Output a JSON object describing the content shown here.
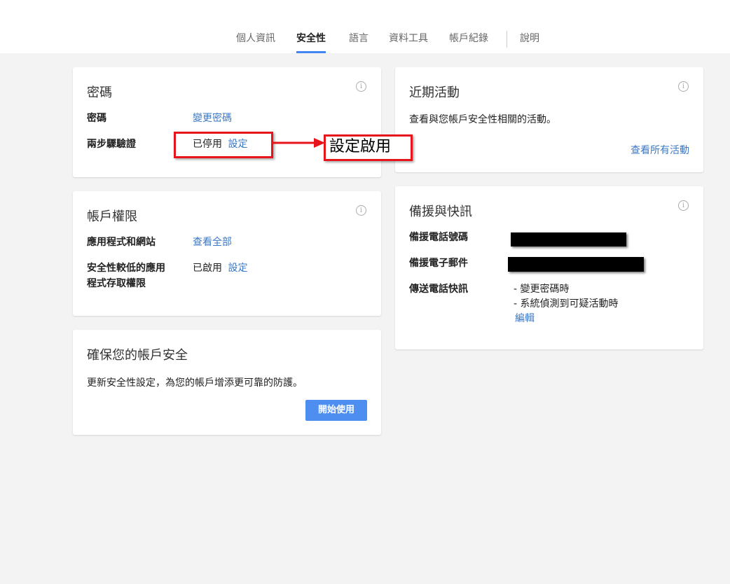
{
  "nav": {
    "tabs": [
      {
        "label": "個人資訊"
      },
      {
        "label": "安全性"
      },
      {
        "label": "語言"
      },
      {
        "label": "資料工具"
      },
      {
        "label": "帳戶紀錄"
      }
    ],
    "help": "說明",
    "active_tab": "安全性"
  },
  "password_card": {
    "title": "密碼",
    "password_label": "密碼",
    "password_link": "變更密碼",
    "twostep_label": "兩步驟驗證",
    "twostep_status": "已停用",
    "twostep_link": "設定"
  },
  "permissions_card": {
    "title": "帳戶權限",
    "apps_label": "應用程式和網站",
    "apps_link": "查看全部",
    "lesssecure_label_1": "安全性較低的應用",
    "lesssecure_label_2": "程式存取權限",
    "lesssecure_status": "已啟用",
    "lesssecure_link": "設定"
  },
  "secure_card": {
    "title": "確保您的帳戶安全",
    "desc": "更新安全性設定，為您的帳戶增添更可靠的防護。",
    "button": "開始使用"
  },
  "activity_card": {
    "title": "近期活動",
    "desc": "查看與您帳戶安全性相關的活動。",
    "link": "查看所有活動"
  },
  "recovery_card": {
    "title": "備援與快訊",
    "phone_label": "備援電話號碼",
    "email_label": "備援電子郵件",
    "alerts_label": "傳送電話快訊",
    "alert_1": "- 變更密碼時",
    "alert_2": "- 系統偵測到可疑活動時",
    "edit_link": "編輯"
  },
  "annotation": {
    "text": "設定啟用",
    "color": "#e8141c"
  },
  "colors": {
    "accent": "#4285f4",
    "link": "#3b78c4",
    "background": "#f3f3f3"
  }
}
